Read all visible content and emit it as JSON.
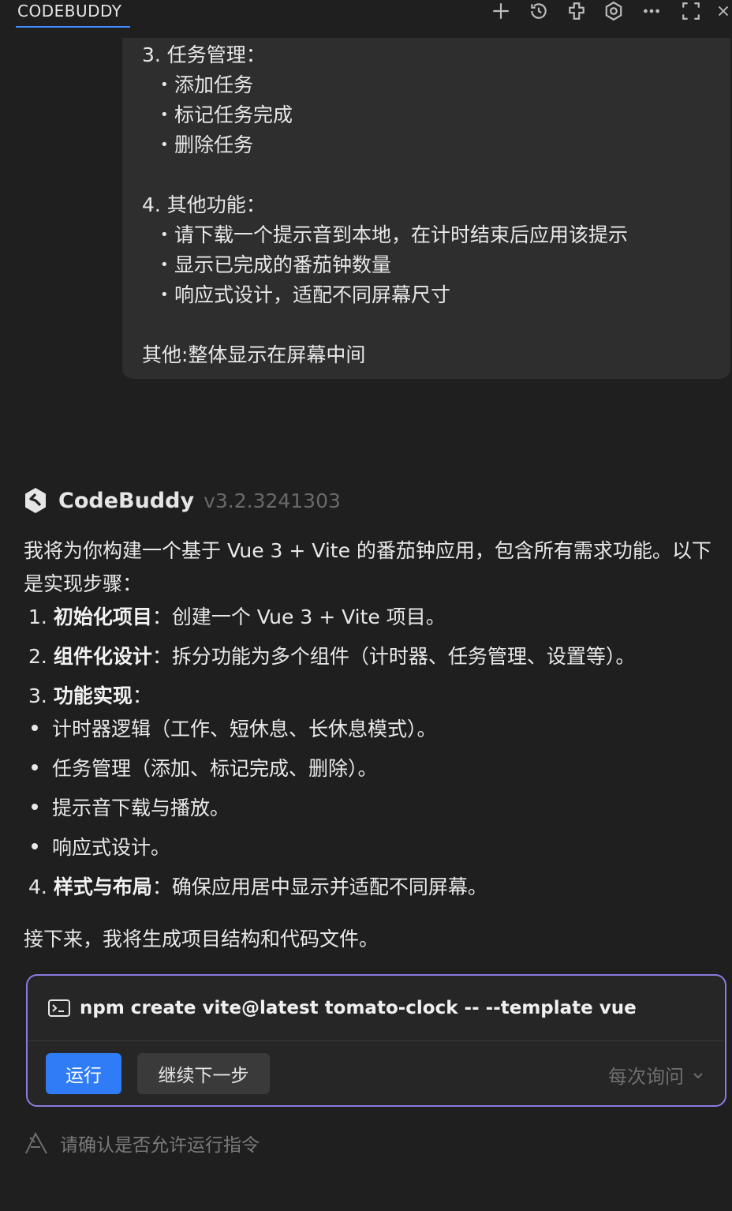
{
  "header": {
    "title": "CODEBUDDY",
    "icons": [
      "plus-icon",
      "history-icon",
      "plugin-icon",
      "settings-icon",
      "more-icon",
      "fullscreen-icon",
      "close-icon"
    ]
  },
  "user_message": {
    "section3_title": "3. 任务管理：",
    "section3_items": [
      "添加任务",
      "标记任务完成",
      "删除任务"
    ],
    "section4_title": "4. 其他功能：",
    "section4_items": [
      "请下载一个提示音到本地，在计时结束后应用该提示",
      "显示已完成的番茄钟数量",
      "响应式设计，适配不同屏幕尺寸"
    ],
    "other": "其他:整体显示在屏幕中间"
  },
  "assistant": {
    "name": "CodeBuddy",
    "version": "v3.2.3241303",
    "intro_line1": "我将为你构建一个基于 Vue 3 + Vite 的番茄钟应用，包含所有需求功能。以下",
    "intro_line2": "是实现步骤：",
    "steps": [
      {
        "num": "1.",
        "title": "初始化项目",
        "text": "：创建一个 Vue 3 + Vite 项目。"
      },
      {
        "num": "2.",
        "title": "组件化设计",
        "text": "：拆分功能为多个组件（计时器、任务管理、设置等）。"
      },
      {
        "num": "3.",
        "title": "功能实现",
        "text": "："
      }
    ],
    "bullets": [
      "计时器逻辑（工作、短休息、长休息模式）。",
      "任务管理（添加、标记完成、删除）。",
      "提示音下载与播放。",
      "响应式设计。"
    ],
    "step4": {
      "num": "4.",
      "title": "样式与布局",
      "text": "：确保应用居中显示并适配不同屏幕。"
    },
    "outro": "接下来，我将生成项目结构和代码文件。"
  },
  "command_card": {
    "command": "npm create vite@latest tomato-clock -- --template vue",
    "run_label": "运行",
    "next_label": "继续下一步",
    "policy_label": "每次询问",
    "border_color": "#8a7be0",
    "run_color": "#2f7cf6"
  },
  "footer": {
    "confirm_text": "请确认是否允许运行指令"
  }
}
